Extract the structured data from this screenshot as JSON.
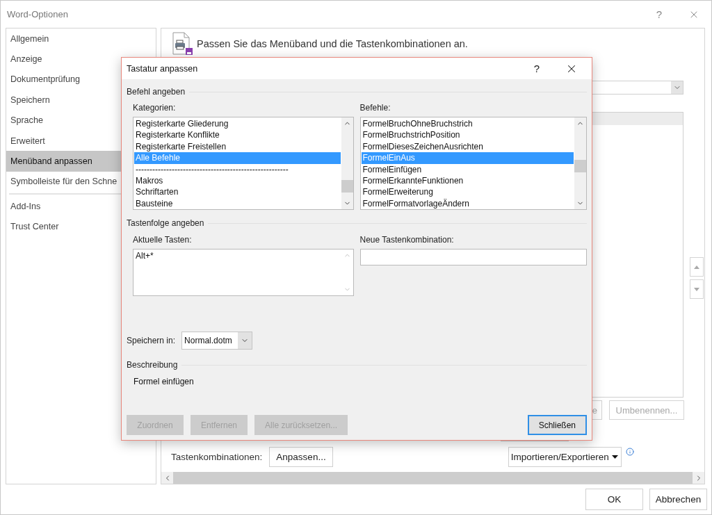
{
  "window": {
    "title": "Word-Optionen",
    "help": "?"
  },
  "sidebar": {
    "groups": [
      {
        "items": [
          {
            "label": "Allgemein",
            "selected": false
          },
          {
            "label": "Anzeige",
            "selected": false
          },
          {
            "label": "Dokumentprüfung",
            "selected": false
          },
          {
            "label": "Speichern",
            "selected": false
          },
          {
            "label": "Sprache",
            "selected": false
          },
          {
            "label": "Erweitert",
            "selected": false
          },
          {
            "label": "Menüband anpassen",
            "selected": true
          },
          {
            "label": "Symbolleiste für den Schne",
            "selected": false
          }
        ]
      },
      {
        "items": [
          {
            "label": "Add-Ins",
            "selected": false
          },
          {
            "label": "Trust Center",
            "selected": false
          }
        ]
      }
    ]
  },
  "main": {
    "heading": "Passen Sie das Menüband und die Tastenkombinationen an.",
    "row_buttons": [
      {
        "label": "e",
        "disabled": true
      },
      {
        "label": "Umbenennen...",
        "disabled": true
      }
    ],
    "shortcuts_label": "Tastenkombinationen:",
    "customize_button": "Anpassen...",
    "import_export_button": "Importieren/Exportieren"
  },
  "dialog": {
    "title": "Tastatur anpassen",
    "help": "?",
    "command_section": "Befehl angeben",
    "categories": {
      "label": "Kategorien:",
      "items": [
        {
          "label": "Registerkarte Gliederung",
          "selected": false
        },
        {
          "label": "Registerkarte Konflikte",
          "selected": false
        },
        {
          "label": "Registerkarte Freistellen",
          "selected": false
        },
        {
          "label": "Alle Befehle",
          "selected": true
        },
        {
          "label": "-------------------------------------------------------",
          "selected": false
        },
        {
          "label": "Makros",
          "selected": false
        },
        {
          "label": "Schriftarten",
          "selected": false
        },
        {
          "label": "Bausteine",
          "selected": false
        }
      ]
    },
    "commands": {
      "label": "Befehle:",
      "items": [
        {
          "label": "FormelBruchOhneBruchstrich",
          "selected": false
        },
        {
          "label": "FormelBruchstrichPosition",
          "selected": false
        },
        {
          "label": "FormelDiesesZeichenAusrichten",
          "selected": false
        },
        {
          "label": "FormelEinAus",
          "selected": true
        },
        {
          "label": "FormelEinfügen",
          "selected": false
        },
        {
          "label": "FormelErkannteFunktionen",
          "selected": false
        },
        {
          "label": "FormelErweiterung",
          "selected": false
        },
        {
          "label": "FormelFormatvorlageÄndern",
          "selected": false
        }
      ]
    },
    "key_section": "Tastenfolge angeben",
    "current_keys": {
      "label": "Aktuelle Tasten:",
      "items": [
        "Alt+*"
      ]
    },
    "new_shortcut": {
      "label": "Neue Tastenkombination:"
    },
    "save_in": {
      "label": "Speichern in:",
      "value": "Normal.dotm"
    },
    "description_section": "Beschreibung",
    "description": "Formel einfügen",
    "buttons": [
      {
        "label": "Zuordnen",
        "disabled": true,
        "default": false
      },
      {
        "label": "Entfernen",
        "disabled": true,
        "default": false
      },
      {
        "label": "Alle zurücksetzen...",
        "disabled": true,
        "default": false
      },
      {
        "label": "Schließen",
        "disabled": false,
        "default": true
      }
    ]
  },
  "footer": {
    "buttons": [
      {
        "label": "OK"
      },
      {
        "label": "Abbrechen"
      }
    ]
  }
}
